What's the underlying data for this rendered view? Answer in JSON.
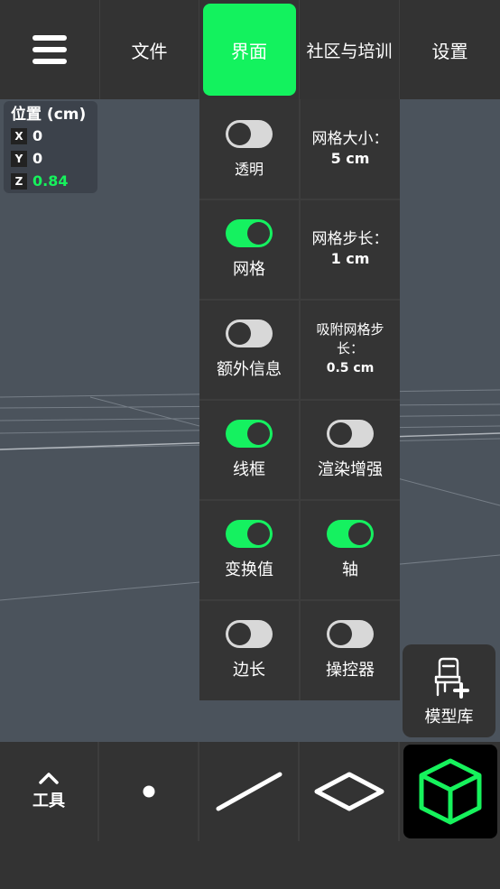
{
  "top_tabs": {
    "file": "文件",
    "interface": "界面",
    "community": "社区与培训",
    "settings": "设置"
  },
  "position_panel": {
    "title": "位置 (cm)",
    "x_label": "X",
    "x_value": "0",
    "y_label": "Y",
    "y_value": "0",
    "z_label": "Z",
    "z_value": "0.84"
  },
  "menu": {
    "transparent": {
      "label": "透明",
      "on": false
    },
    "grid_size": {
      "title": "网格大小：",
      "value": "5 cm"
    },
    "grid": {
      "label": "网格",
      "on": true
    },
    "grid_step": {
      "title": "网格步长：",
      "value": "1 cm"
    },
    "extra_info": {
      "label": "额外信息",
      "on": false
    },
    "snap_grid_step": {
      "title": "吸附网格步长：",
      "value": "0.5 cm"
    },
    "wireframe": {
      "label": "线框",
      "on": true
    },
    "render_enhance": {
      "label": "渲染增强",
      "on": false
    },
    "transform_values": {
      "label": "变换值",
      "on": true
    },
    "axis": {
      "label": "轴",
      "on": true
    },
    "edge_length": {
      "label": "边长",
      "on": false
    },
    "manipulator": {
      "label": "操控器",
      "on": false
    }
  },
  "model_library": {
    "label": "模型库",
    "icon": "chair-add-icon"
  },
  "bottom_tools": {
    "tools_label": "工具",
    "point_icon": "point-icon",
    "line_icon": "line-icon",
    "plane_icon": "plane-icon",
    "cube_icon": "cube-icon"
  },
  "colors": {
    "accent": "#13f25e",
    "panel": "#333333",
    "viewport": "#4b535c"
  }
}
